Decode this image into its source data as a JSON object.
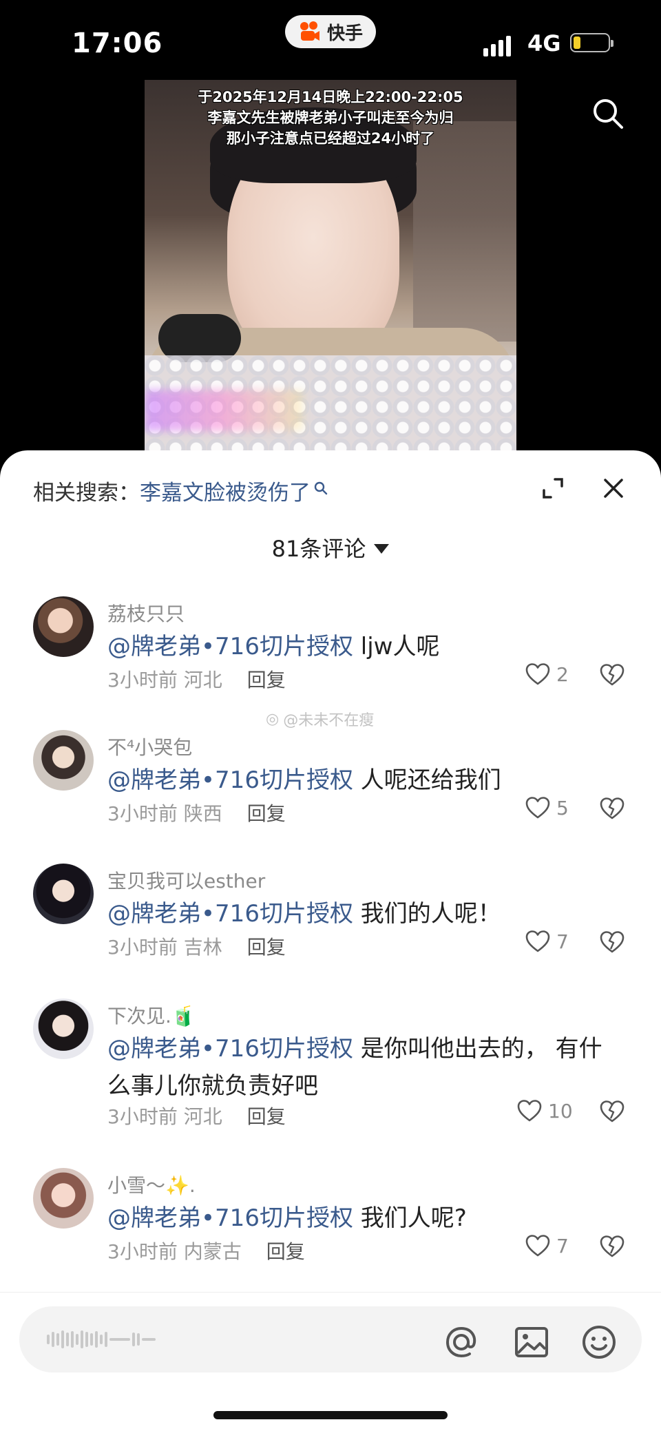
{
  "status_bar": {
    "time": "17:06",
    "app_name": "快手",
    "network": "4G",
    "battery_level": 0.2,
    "colors": {
      "battery_fill": "#f4d02a",
      "app_logo": "#ff5000"
    }
  },
  "video": {
    "caption_lines": [
      "于2025年12月14日晚上22:00-22:05",
      "李嘉文先生被牌老弟小子叫走至今为归",
      "那小子注意点已经超过24小时了"
    ]
  },
  "panel": {
    "related_label": "相关搜索：",
    "related_query": "李嘉文脸被烫伤了",
    "comment_count": "81条评论",
    "watermark": "@未未不在瘦"
  },
  "comments": [
    {
      "username": "荔枝只只",
      "mention": "@牌老弟•716切片授权",
      "text": " ljw人呢",
      "time": "3小时前",
      "region": "河北",
      "reply": "回复",
      "likes": "2"
    },
    {
      "username": "不⁴小哭包",
      "mention": "@牌老弟•716切片授权",
      "text": " 人呢还给我们",
      "time": "3小时前",
      "region": "陕西",
      "reply": "回复",
      "likes": "5"
    },
    {
      "username": "宝贝我可以esther",
      "mention": "@牌老弟•716切片授权",
      "text": " 我们的人呢！",
      "time": "3小时前",
      "region": "吉林",
      "reply": "回复",
      "likes": "7"
    },
    {
      "username": "下次见.🧃",
      "mention": "@牌老弟•716切片授权",
      "text": " 是你叫他出去的， 有什么事儿你就负责好吧",
      "time": "3小时前",
      "region": "河北",
      "reply": "回复",
      "likes": "10"
    },
    {
      "username": "小雪～✨.",
      "mention": "@牌老弟•716切片授权",
      "text": "  我们人呢?",
      "time": "3小时前",
      "region": "内蒙古",
      "reply": "回复",
      "likes": "7"
    }
  ],
  "input_bar": {
    "icons": [
      "at-icon",
      "image-icon",
      "emoji-icon"
    ]
  }
}
